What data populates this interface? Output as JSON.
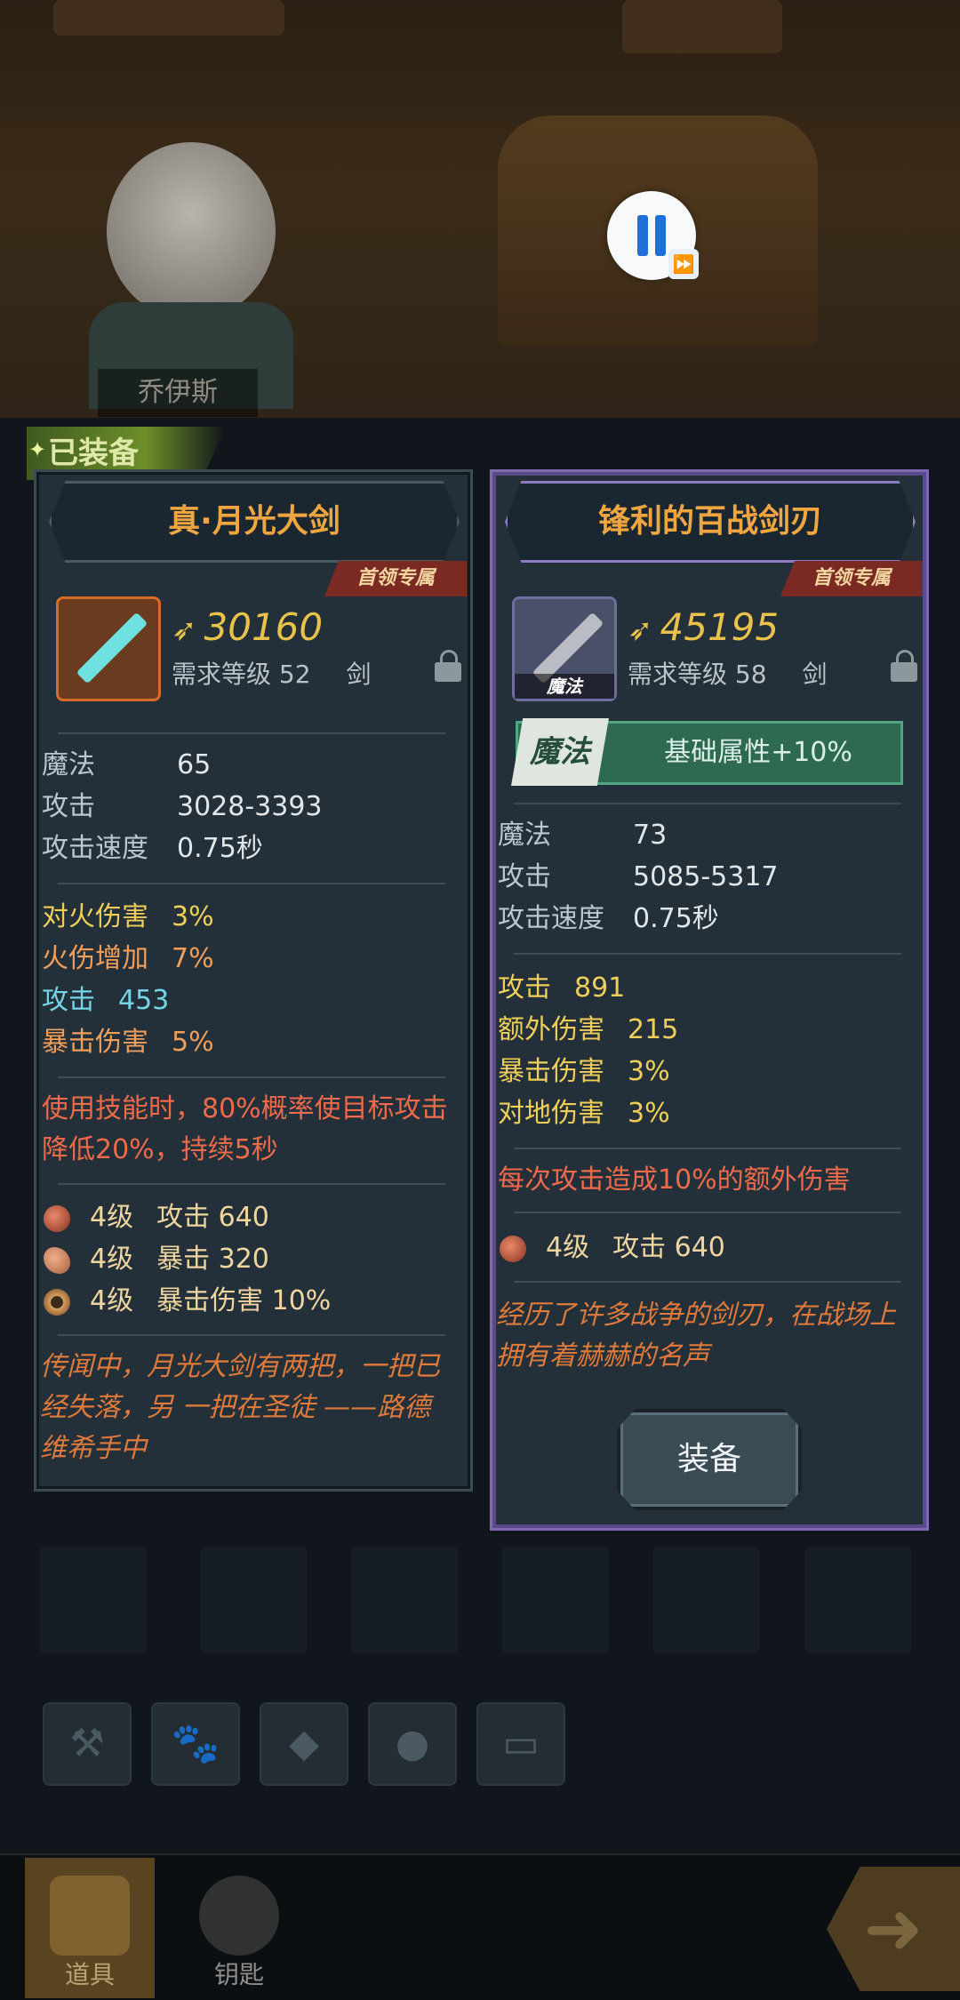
{
  "character": {
    "name": "乔伊斯"
  },
  "equipped_label": "已装备",
  "equipped_item": {
    "name": "真·月光大剑",
    "exclusive": "首领专属",
    "power": "30160",
    "req_level_label": "需求等级 52",
    "weapon_type": "剑",
    "stats": [
      {
        "label": "魔法",
        "value": "65"
      },
      {
        "label": "攻击",
        "value": "3028-3393"
      },
      {
        "label": "攻击速度",
        "value": "0.75秒"
      }
    ],
    "bonuses": [
      {
        "label": "对火伤害",
        "value": "3%"
      },
      {
        "label": "火伤增加",
        "value": "7%"
      },
      {
        "label": "攻击",
        "value": "453"
      },
      {
        "label": "暴击伤害",
        "value": "5%"
      }
    ],
    "special": "使用技能时，80%概率使目标攻击降低20%，持续5秒",
    "gems": [
      {
        "level": "4级",
        "effect": "攻击 640"
      },
      {
        "level": "4级",
        "effect": "暴击 320"
      },
      {
        "level": "4级",
        "effect": "暴击伤害 10%"
      }
    ],
    "lore": "传闻中，月光大剑有两把，一把已经失落，另 一把在圣徒 ——路德维希手中"
  },
  "compare_item": {
    "name": "锋利的百战剑刃",
    "exclusive": "首领专属",
    "icon_tag": "魔法",
    "power": "45195",
    "req_level_label": "需求等级 58",
    "weapon_type": "剑",
    "magic_tag": "魔法",
    "magic_text": "基础属性+10%",
    "stats": [
      {
        "label": "魔法",
        "value": "73"
      },
      {
        "label": "攻击",
        "value": "5085-5317"
      },
      {
        "label": "攻击速度",
        "value": "0.75秒"
      }
    ],
    "bonuses": [
      {
        "label": "攻击",
        "value": "891"
      },
      {
        "label": "额外伤害",
        "value": "215"
      },
      {
        "label": "暴击伤害",
        "value": "3%"
      },
      {
        "label": "对地伤害",
        "value": "3%"
      }
    ],
    "special": "每次攻击造成10%的额外伤害",
    "gems": [
      {
        "level": "4级",
        "effect": "攻击 640"
      }
    ],
    "lore": "经历了许多战争的剑刃，在战场上拥有着赫赫的名声",
    "equip_button": "装备"
  },
  "bottom_tabs": {
    "items": "道具",
    "keys": "钥匙"
  },
  "icons": {
    "power": "power-arrow-icon",
    "lock": "lock-icon",
    "pause": "pause-icon",
    "fast_forward": "fast-forward-icon"
  }
}
